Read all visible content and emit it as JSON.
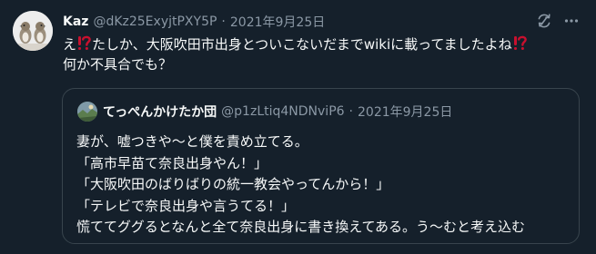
{
  "tweet": {
    "author_name": "Kaz",
    "handle": "@dKz25ExyjtPXY5P",
    "separator": "·",
    "date": "2021年9月25日",
    "line1_a": "え",
    "line1_b": "たしか、大阪吹田市出身とついこないだまでwikiに載ってましたよね",
    "line2": "何か不具合でも？",
    "icons": [
      "translate-icon",
      "more-icon",
      "exclamation-question-icon"
    ]
  },
  "quoted_tweet": {
    "author_name": "てっぺんかけたか団",
    "handle": "@p1zLtiq4NDNviP6",
    "separator": "·",
    "date": "2021年9月25日",
    "lines": [
      "妻が、嘘つきや～と僕を責め立てる。",
      "「高市早苗て奈良出身やん！」",
      "「大阪吹田のばりばりの統一教会やってんから！」",
      "「テレビで奈良出身や言うてる！」",
      "慌ててググるとなんと全て奈良出身に書き換えてある。う～むと考え込む"
    ]
  },
  "colors": {
    "background": "#15202b",
    "text": "#f7f9f9",
    "muted": "#8b98a5",
    "border": "#38444d",
    "emoji_red": "#c8102e"
  }
}
